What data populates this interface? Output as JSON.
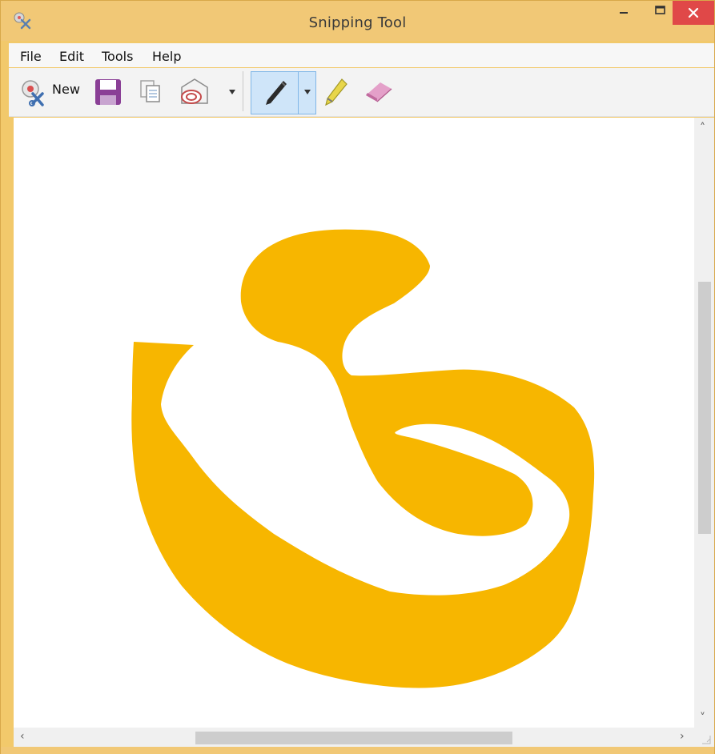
{
  "window": {
    "title": "Snipping Tool"
  },
  "menu": {
    "items": [
      "File",
      "Edit",
      "Tools",
      "Help"
    ]
  },
  "toolbar": {
    "new_label": "New",
    "icons": [
      "new-snip-icon",
      "save-icon",
      "copy-icon",
      "send-snip-icon",
      "pen-icon",
      "highlighter-icon",
      "eraser-icon"
    ],
    "active_tool": "pen"
  },
  "canvas": {
    "ink_color": "#F7B600"
  }
}
